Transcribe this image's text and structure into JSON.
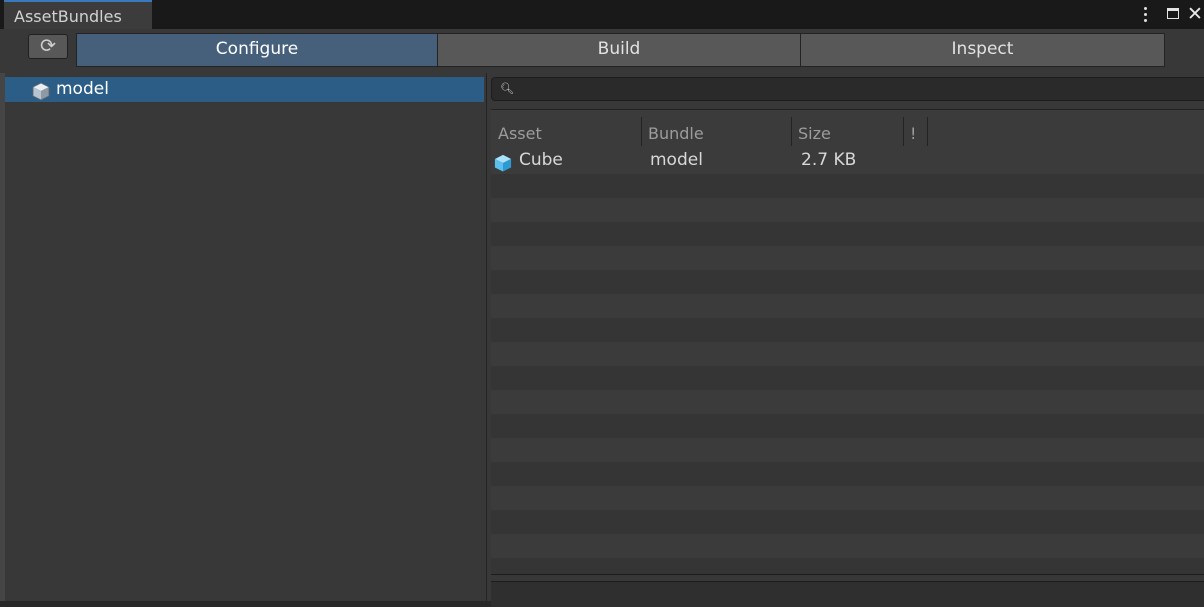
{
  "window": {
    "tab_title": "AssetBundles",
    "menu_icon": "more-vert-icon",
    "maximize_icon": "maximize-icon",
    "close_icon": "close-icon"
  },
  "toolbar": {
    "refresh_icon": "refresh-icon",
    "tabs": [
      {
        "label": "Configure",
        "active": true
      },
      {
        "label": "Build",
        "active": false
      },
      {
        "label": "Inspect",
        "active": false
      }
    ]
  },
  "bundle_tree": {
    "items": [
      {
        "label": "model",
        "icon": "bundle-cube-icon",
        "selected": true
      }
    ]
  },
  "asset_list": {
    "search": {
      "value": "",
      "icon": "search-icon"
    },
    "columns": [
      "Asset",
      "Bundle",
      "Size",
      "!"
    ],
    "rows": [
      {
        "asset": "Cube",
        "bundle": "model",
        "size": "2.7 KB",
        "icon": "prefab-cube-icon"
      }
    ]
  },
  "colors": {
    "accent": "#3a79bb",
    "selection": "#2c5d87",
    "active_tab": "#46607c",
    "cube_blue": "#5cc0ee"
  }
}
